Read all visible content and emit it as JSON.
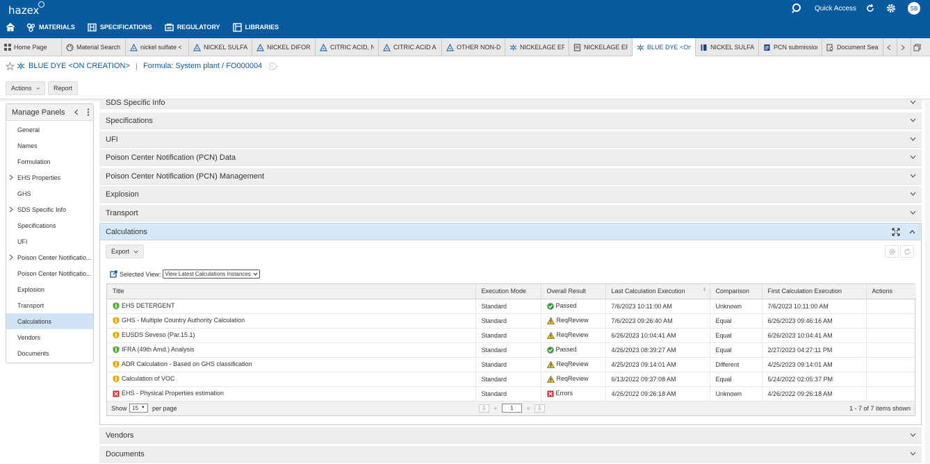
{
  "app": {
    "logo": "hazex",
    "quick_access": "Quick Access",
    "user_initials": "SB"
  },
  "main_nav": [
    {
      "label": "MATERIALS",
      "icon": "materials-icon"
    },
    {
      "label": "SPECIFICATIONS",
      "icon": "specifications-icon"
    },
    {
      "label": "REGULATORY",
      "icon": "regulatory-icon"
    },
    {
      "label": "LIBRARIES",
      "icon": "libraries-icon"
    }
  ],
  "tabs": [
    {
      "label": "Home Page",
      "icon": "grid-icon"
    },
    {
      "label": "Material Search",
      "icon": "palette-icon"
    },
    {
      "label": "nickel sulfate <",
      "icon": "flask-icon"
    },
    {
      "label": "NICKEL SULFAT",
      "icon": "flask-icon"
    },
    {
      "label": "NICKEL DIFORI",
      "icon": "flask-icon"
    },
    {
      "label": "CITRIC ACID, N",
      "icon": "flask-icon"
    },
    {
      "label": "CITRIC ACID A",
      "icon": "flask-icon"
    },
    {
      "label": "OTHER NON-De",
      "icon": "flask-icon"
    },
    {
      "label": "NICKELAGE EP",
      "icon": "molecule-icon"
    },
    {
      "label": "NICKELAGE EP",
      "icon": "document-icon"
    },
    {
      "label": "BLUE DYE <On",
      "icon": "molecule-icon",
      "active": true
    },
    {
      "label": "NICKEL SULFAT",
      "icon": "book-icon"
    },
    {
      "label": "PCN submission",
      "icon": "report-icon"
    },
    {
      "label": "Document Sear",
      "icon": "search-doc-icon"
    }
  ],
  "breadcrumb": {
    "title": "BLUE DYE <ON CREATION>",
    "formula": "Formula: System plant / FO000004"
  },
  "toolbar": {
    "actions": "Actions",
    "report": "Report"
  },
  "manage_panels": {
    "title": "Manage Panels",
    "items": [
      {
        "label": "General",
        "expandable": false
      },
      {
        "label": "Names",
        "expandable": false
      },
      {
        "label": "Formulation",
        "expandable": false
      },
      {
        "label": "EHS Properties",
        "expandable": true
      },
      {
        "label": "GHS",
        "expandable": false
      },
      {
        "label": "SDS Specific Info",
        "expandable": true
      },
      {
        "label": "Specifications",
        "expandable": false
      },
      {
        "label": "UFI",
        "expandable": false
      },
      {
        "label": "Poison Center Notificatio...",
        "expandable": true
      },
      {
        "label": "Poison Center Notificatio...",
        "expandable": false
      },
      {
        "label": "Explosion",
        "expandable": false
      },
      {
        "label": "Transport",
        "expandable": false
      },
      {
        "label": "Calculations",
        "expandable": false,
        "active": true
      },
      {
        "label": "Vendors",
        "expandable": false
      },
      {
        "label": "Documents",
        "expandable": false
      }
    ]
  },
  "sections": [
    "SDS Specific Info",
    "Specifications",
    "UFI",
    "Poison Center Notification (PCN) Data",
    "Poison Center Notification (PCN) Management",
    "Explosion",
    "Transport"
  ],
  "sections_after": [
    "Vendors",
    "Documents"
  ],
  "calculations": {
    "title": "Calculations",
    "export": "Export",
    "selected_view_label": "Selected View:",
    "selected_view_value": "View Latest Calculations Instances",
    "columns": [
      "Title",
      "Execution Mode",
      "Overall Result",
      "Last Calculation Execution",
      "Comparison",
      "First Calculation Execution",
      "Actions"
    ],
    "rows": [
      {
        "icon": "shield-green",
        "title": "EHS DETERGENT",
        "mode": "Standard",
        "result_icon": "check",
        "result": "Passed",
        "last": "7/6/2023 10:11:00 AM",
        "comparison": "Unknown",
        "first": "7/6/2023 10:11:00 AM"
      },
      {
        "icon": "shield-yellow",
        "title": "GHS - Multiple Country Authority Calculation",
        "mode": "Standard",
        "result_icon": "warning",
        "result": "ReqReview",
        "last": "7/6/2023 09:26:40 AM",
        "comparison": "Equal",
        "first": "6/26/2023 09:46:16 AM"
      },
      {
        "icon": "shield-yellow",
        "title": "EUSDS Seveso (Par.15.1)",
        "mode": "Standard",
        "result_icon": "warning",
        "result": "ReqReview",
        "last": "6/26/2023 10:04:41 AM",
        "comparison": "Equal",
        "first": "6/26/2023 10:04:41 AM"
      },
      {
        "icon": "shield-green",
        "title": "IFRA (49th Amd.) Analysis",
        "mode": "Standard",
        "result_icon": "check",
        "result": "Passed",
        "last": "4/26/2023 08:39:27 AM",
        "comparison": "Equal",
        "first": "2/27/2023 04:27:11 PM"
      },
      {
        "icon": "shield-yellow",
        "title": "ADR Calculation - Based on GHS classification",
        "mode": "Standard",
        "result_icon": "warning",
        "result": "ReqReview",
        "last": "4/25/2023 09:14:01 AM",
        "comparison": "Different",
        "first": "4/25/2023 09:14:01 AM"
      },
      {
        "icon": "shield-yellow",
        "title": "Calculation of VOC",
        "mode": "Standard",
        "result_icon": "warning",
        "result": "ReqReview",
        "last": "6/13/2022 09:37:08 AM",
        "comparison": "Equal",
        "first": "5/24/2022 02:05:37 PM"
      },
      {
        "icon": "error-red",
        "title": "EHS - Physical Properties estimation",
        "mode": "Standard",
        "result_icon": "error",
        "result": "Errors",
        "last": "4/26/2022 09:26:18 AM",
        "comparison": "Unknown",
        "first": "4/26/2022 09:26:18 AM"
      }
    ],
    "pager": {
      "show": "Show",
      "page_size": "15",
      "per_page": "per page",
      "page": "1",
      "first_page": "1",
      "last_page": "1",
      "summary": "1 - 7 of 7 items shown"
    }
  },
  "colors": {
    "brand": "#0a5aa0",
    "active_panel": "#cfe3f5",
    "passed": "#3a9a3a",
    "warning": "#f2c200",
    "error": "#d9262c"
  }
}
